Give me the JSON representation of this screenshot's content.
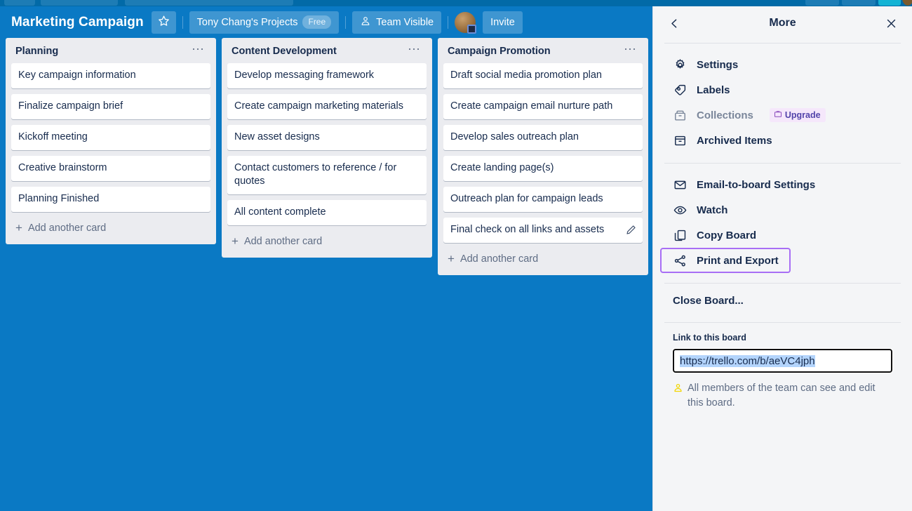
{
  "top_strip": {
    "present": true
  },
  "board": {
    "background_color": "#0a79c4",
    "header": {
      "title": "Marketing Campaign",
      "star_icon": "star-icon",
      "project_name": "Tony Chang's Projects",
      "plan_badge": "Free",
      "visibility_icon": "team-icon",
      "visibility_label": "Team Visible",
      "avatar": "member-avatar",
      "invite_label": "Invite"
    },
    "lists": [
      {
        "title": "Planning",
        "menu_icon": "list-menu-icon",
        "cards": [
          {
            "text": "Key campaign information"
          },
          {
            "text": "Finalize campaign brief"
          },
          {
            "text": "Kickoff meeting"
          },
          {
            "text": "Creative brainstorm"
          },
          {
            "text": "Planning Finished"
          }
        ],
        "add_card_label": "Add another card"
      },
      {
        "title": "Content Development",
        "menu_icon": "list-menu-icon",
        "cards": [
          {
            "text": "Develop messaging framework"
          },
          {
            "text": "Create campaign marketing materials"
          },
          {
            "text": "New asset designs"
          },
          {
            "text": "Contact customers to reference / for quotes"
          },
          {
            "text": "All content complete"
          }
        ],
        "add_card_label": "Add another card"
      },
      {
        "title": "Campaign Promotion",
        "menu_icon": "list-menu-icon",
        "cards": [
          {
            "text": "Draft social media promotion plan"
          },
          {
            "text": "Create campaign email nurture path"
          },
          {
            "text": "Develop sales outreach plan"
          },
          {
            "text": "Create landing page(s)"
          },
          {
            "text": "Outreach plan for campaign leads"
          },
          {
            "text": "Final check on all links and assets",
            "edit_icon": "pencil-icon"
          }
        ],
        "add_card_label": "Add another card"
      }
    ]
  },
  "sidebar": {
    "back_icon": "chevron-left-icon",
    "title": "More",
    "close_icon": "close-icon",
    "group_one": [
      {
        "icon": "gear-icon",
        "label": "Settings",
        "disabled": false
      },
      {
        "icon": "label-tag-icon",
        "label": "Labels",
        "disabled": false
      },
      {
        "icon": "collections-box-icon",
        "label": "Collections",
        "disabled": true,
        "badge": "Upgrade",
        "badge_icon": "briefcase-icon"
      },
      {
        "icon": "archive-box-icon",
        "label": "Archived Items",
        "disabled": false
      }
    ],
    "group_two": [
      {
        "icon": "envelope-icon",
        "label": "Email-to-board Settings",
        "highlighted": false
      },
      {
        "icon": "eye-icon",
        "label": "Watch",
        "highlighted": false
      },
      {
        "icon": "copy-icon",
        "label": "Copy Board",
        "highlighted": false
      },
      {
        "icon": "share-icon",
        "label": "Print and Export",
        "highlighted": true
      }
    ],
    "close_board_label": "Close Board...",
    "link_section": {
      "label": "Link to this board",
      "url_value": "https://trello.com/b/aeVC4jph",
      "note_icon": "team-icon",
      "note_text": "All members of the team can see and edit this board."
    },
    "highlight_color": "#a86ef5",
    "focus_border_color": "#0079bf"
  }
}
